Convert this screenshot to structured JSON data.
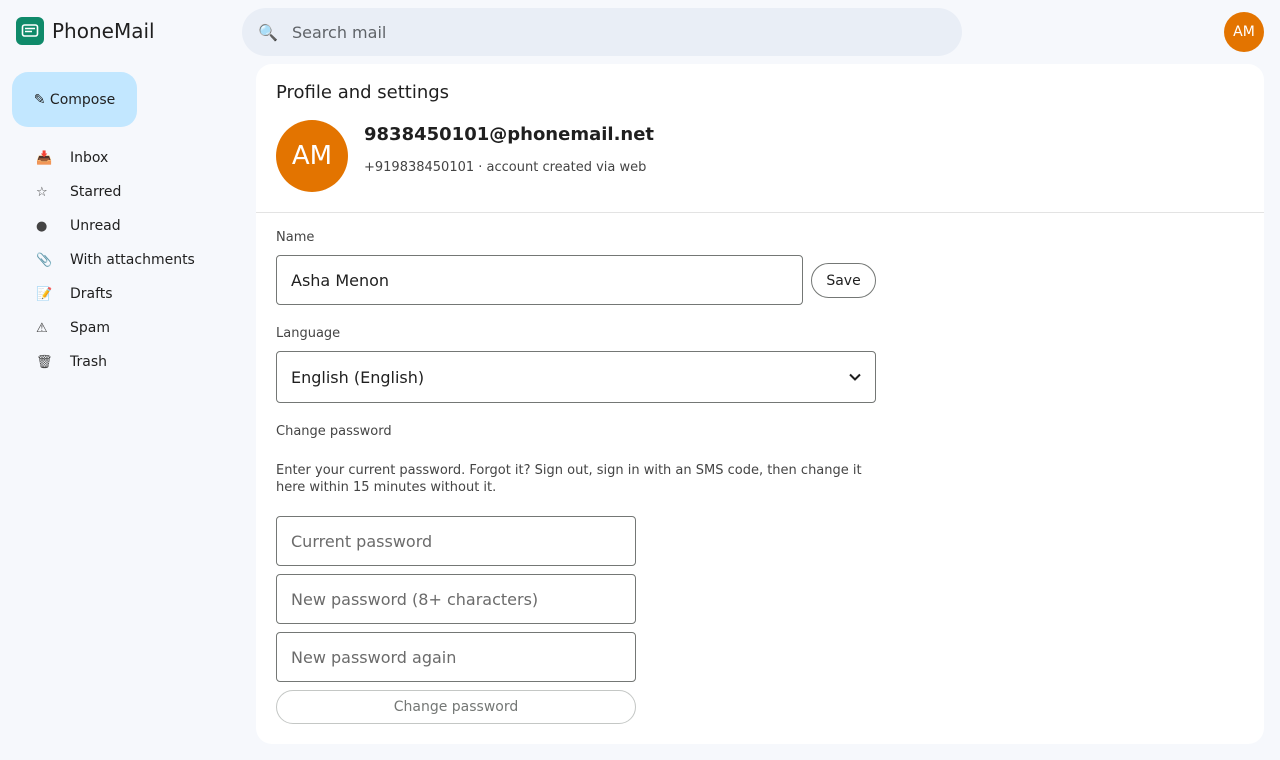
{
  "app": {
    "name": "PhoneMail",
    "logo_icon": "mail-envelope-icon",
    "brand_color": "#0f8a6a"
  },
  "search": {
    "placeholder": "Search mail",
    "icon": "search-icon"
  },
  "account": {
    "initials": "AM",
    "avatar_color": "#e37400"
  },
  "compose": {
    "label": "✎ Compose",
    "bg_color": "#c2e7ff"
  },
  "sidebar": {
    "items": [
      {
        "label": "Inbox",
        "icon": "📥",
        "icon_name": "inbox-icon"
      },
      {
        "label": "Starred",
        "icon": "☆",
        "icon_name": "star-icon"
      },
      {
        "label": "Unread",
        "icon": "●",
        "icon_name": "unread-dot-icon"
      },
      {
        "label": "With attachments",
        "icon": "📎",
        "icon_name": "paperclip-icon"
      },
      {
        "label": "Drafts",
        "icon": "📝",
        "icon_name": "draft-icon"
      },
      {
        "label": "Spam",
        "icon": "⚠",
        "icon_name": "warning-icon"
      },
      {
        "label": "Trash",
        "icon": "🗑",
        "icon_name": "trash-icon"
      }
    ]
  },
  "profile": {
    "title": "Profile and settings",
    "initials": "AM",
    "email": "9838450101@phonemail.net",
    "subtitle": "+919838450101 · account created via web",
    "name_label": "Name",
    "name_value": "Asha Menon",
    "save_label": "Save",
    "language_label": "Language",
    "language_value": "English (English)",
    "password_section_label": "Change password",
    "password_help": "Enter your current password. Forgot it? Sign out, sign in with an SMS code, then change it here within 15 minutes without it.",
    "current_password_placeholder": "Current password",
    "new_password_placeholder": "New password (8+ characters)",
    "confirm_password_placeholder": "New password again",
    "change_password_label": "Change password"
  }
}
